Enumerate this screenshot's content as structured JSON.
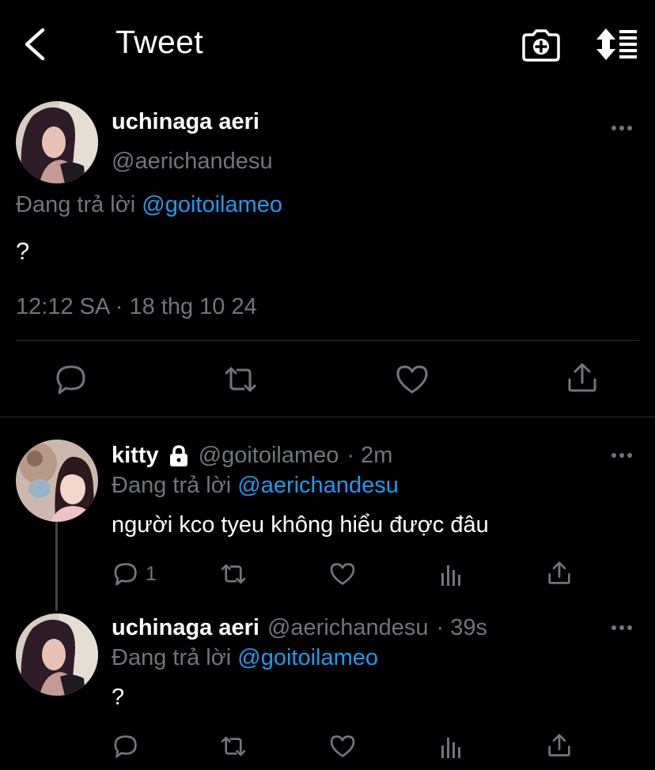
{
  "header": {
    "title": "Tweet"
  },
  "main_tweet": {
    "name": "uchinaga aeri",
    "handle": "@aerichandesu",
    "reply_prefix": "Đang trả lời",
    "reply_to": "@goitoilameo",
    "text": "?",
    "timestamp": "12:12 SA · 18 thg 10 24"
  },
  "replies": [
    {
      "name": "kitty",
      "handle": "@goitoilameo",
      "time": "· 2m",
      "reply_prefix": "Đang trả lời",
      "reply_to": "@aerichandesu",
      "text": "người kco tyeu không hiểu được đâu",
      "reply_count": "1",
      "locked": true
    },
    {
      "name": "uchinaga aeri",
      "handle": "@aerichandesu",
      "time": "· 39s",
      "reply_prefix": "Đang trả lời",
      "reply_to": "@goitoilameo",
      "text": "?",
      "reply_count": "",
      "locked": false
    }
  ],
  "icons": {
    "back": "chevron-left-icon",
    "camera": "camera-plus-icon",
    "sort": "sort-icon",
    "more": "more-horizontal-icon",
    "reply": "reply-icon",
    "retweet": "retweet-icon",
    "like": "heart-icon",
    "analytics": "analytics-icon",
    "share": "share-icon",
    "lock": "lock-icon"
  },
  "colors": {
    "background": "#000000",
    "muted": "#6e767d",
    "accent": "#1d9bf0",
    "divider": "#2f3336"
  }
}
